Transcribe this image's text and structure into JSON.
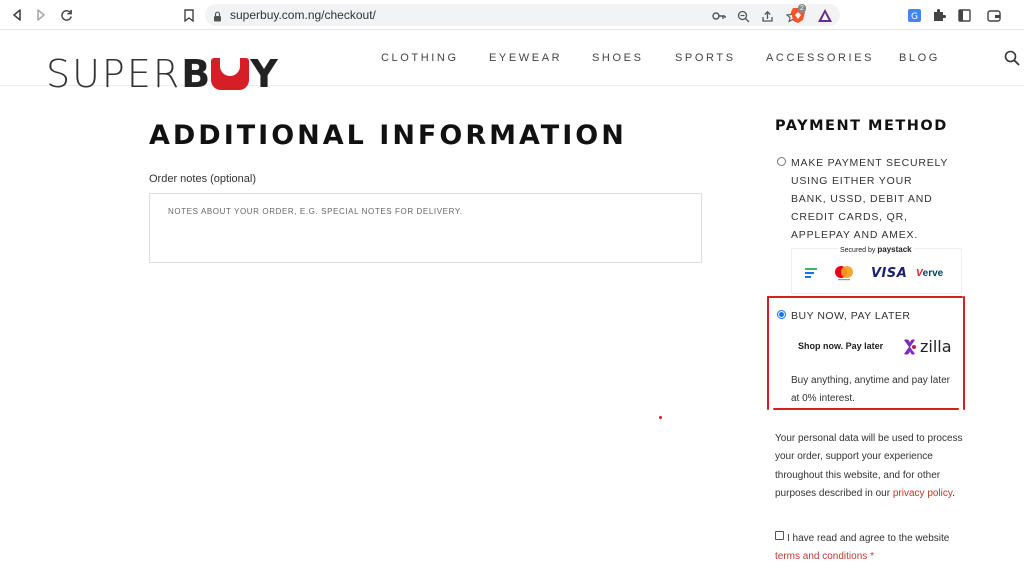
{
  "browser": {
    "url": "superbuy.com.ng/checkout/",
    "brave_badge": "2"
  },
  "header": {
    "logo_thin": "SUPER",
    "logo_b": "B",
    "logo_y": "Y",
    "nav": [
      "CLOTHING",
      "EYEWEAR",
      "SHOES",
      "SPORTS",
      "ACCESSORIES",
      "BLOG"
    ]
  },
  "main": {
    "title": "ADDITIONAL INFORMATION",
    "order_notes_label": "Order notes (optional)",
    "order_notes_placeholder": "NOTES ABOUT YOUR ORDER, E.G. SPECIAL NOTES FOR DELIVERY."
  },
  "payment": {
    "title": "PAYMENT METHOD",
    "option1": {
      "label": "MAKE PAYMENT SECURELY USING EITHER YOUR BANK, USSD, DEBIT AND CREDIT CARDS, QR, APPLEPAY AND AMEX.",
      "selected": false,
      "secured_by": "Secured by",
      "paystack": "paystack",
      "cards": [
        "VISA",
        "erve"
      ]
    },
    "option2": {
      "label": "BUY NOW, PAY LATER",
      "selected": true,
      "shop_now": "Shop now. Pay later",
      "brand": "zilla",
      "description": "Buy anything, anytime and pay later at 0% interest."
    },
    "highlight_color": "#d61e26"
  },
  "privacy": {
    "text": "Your personal data will be used to process your order, support your experience throughout this website, and for other purposes described in our ",
    "link": "privacy policy",
    "suffix": "."
  },
  "terms": {
    "text": "I have read and agree to the website",
    "link": "terms and conditions",
    "required": "*"
  }
}
